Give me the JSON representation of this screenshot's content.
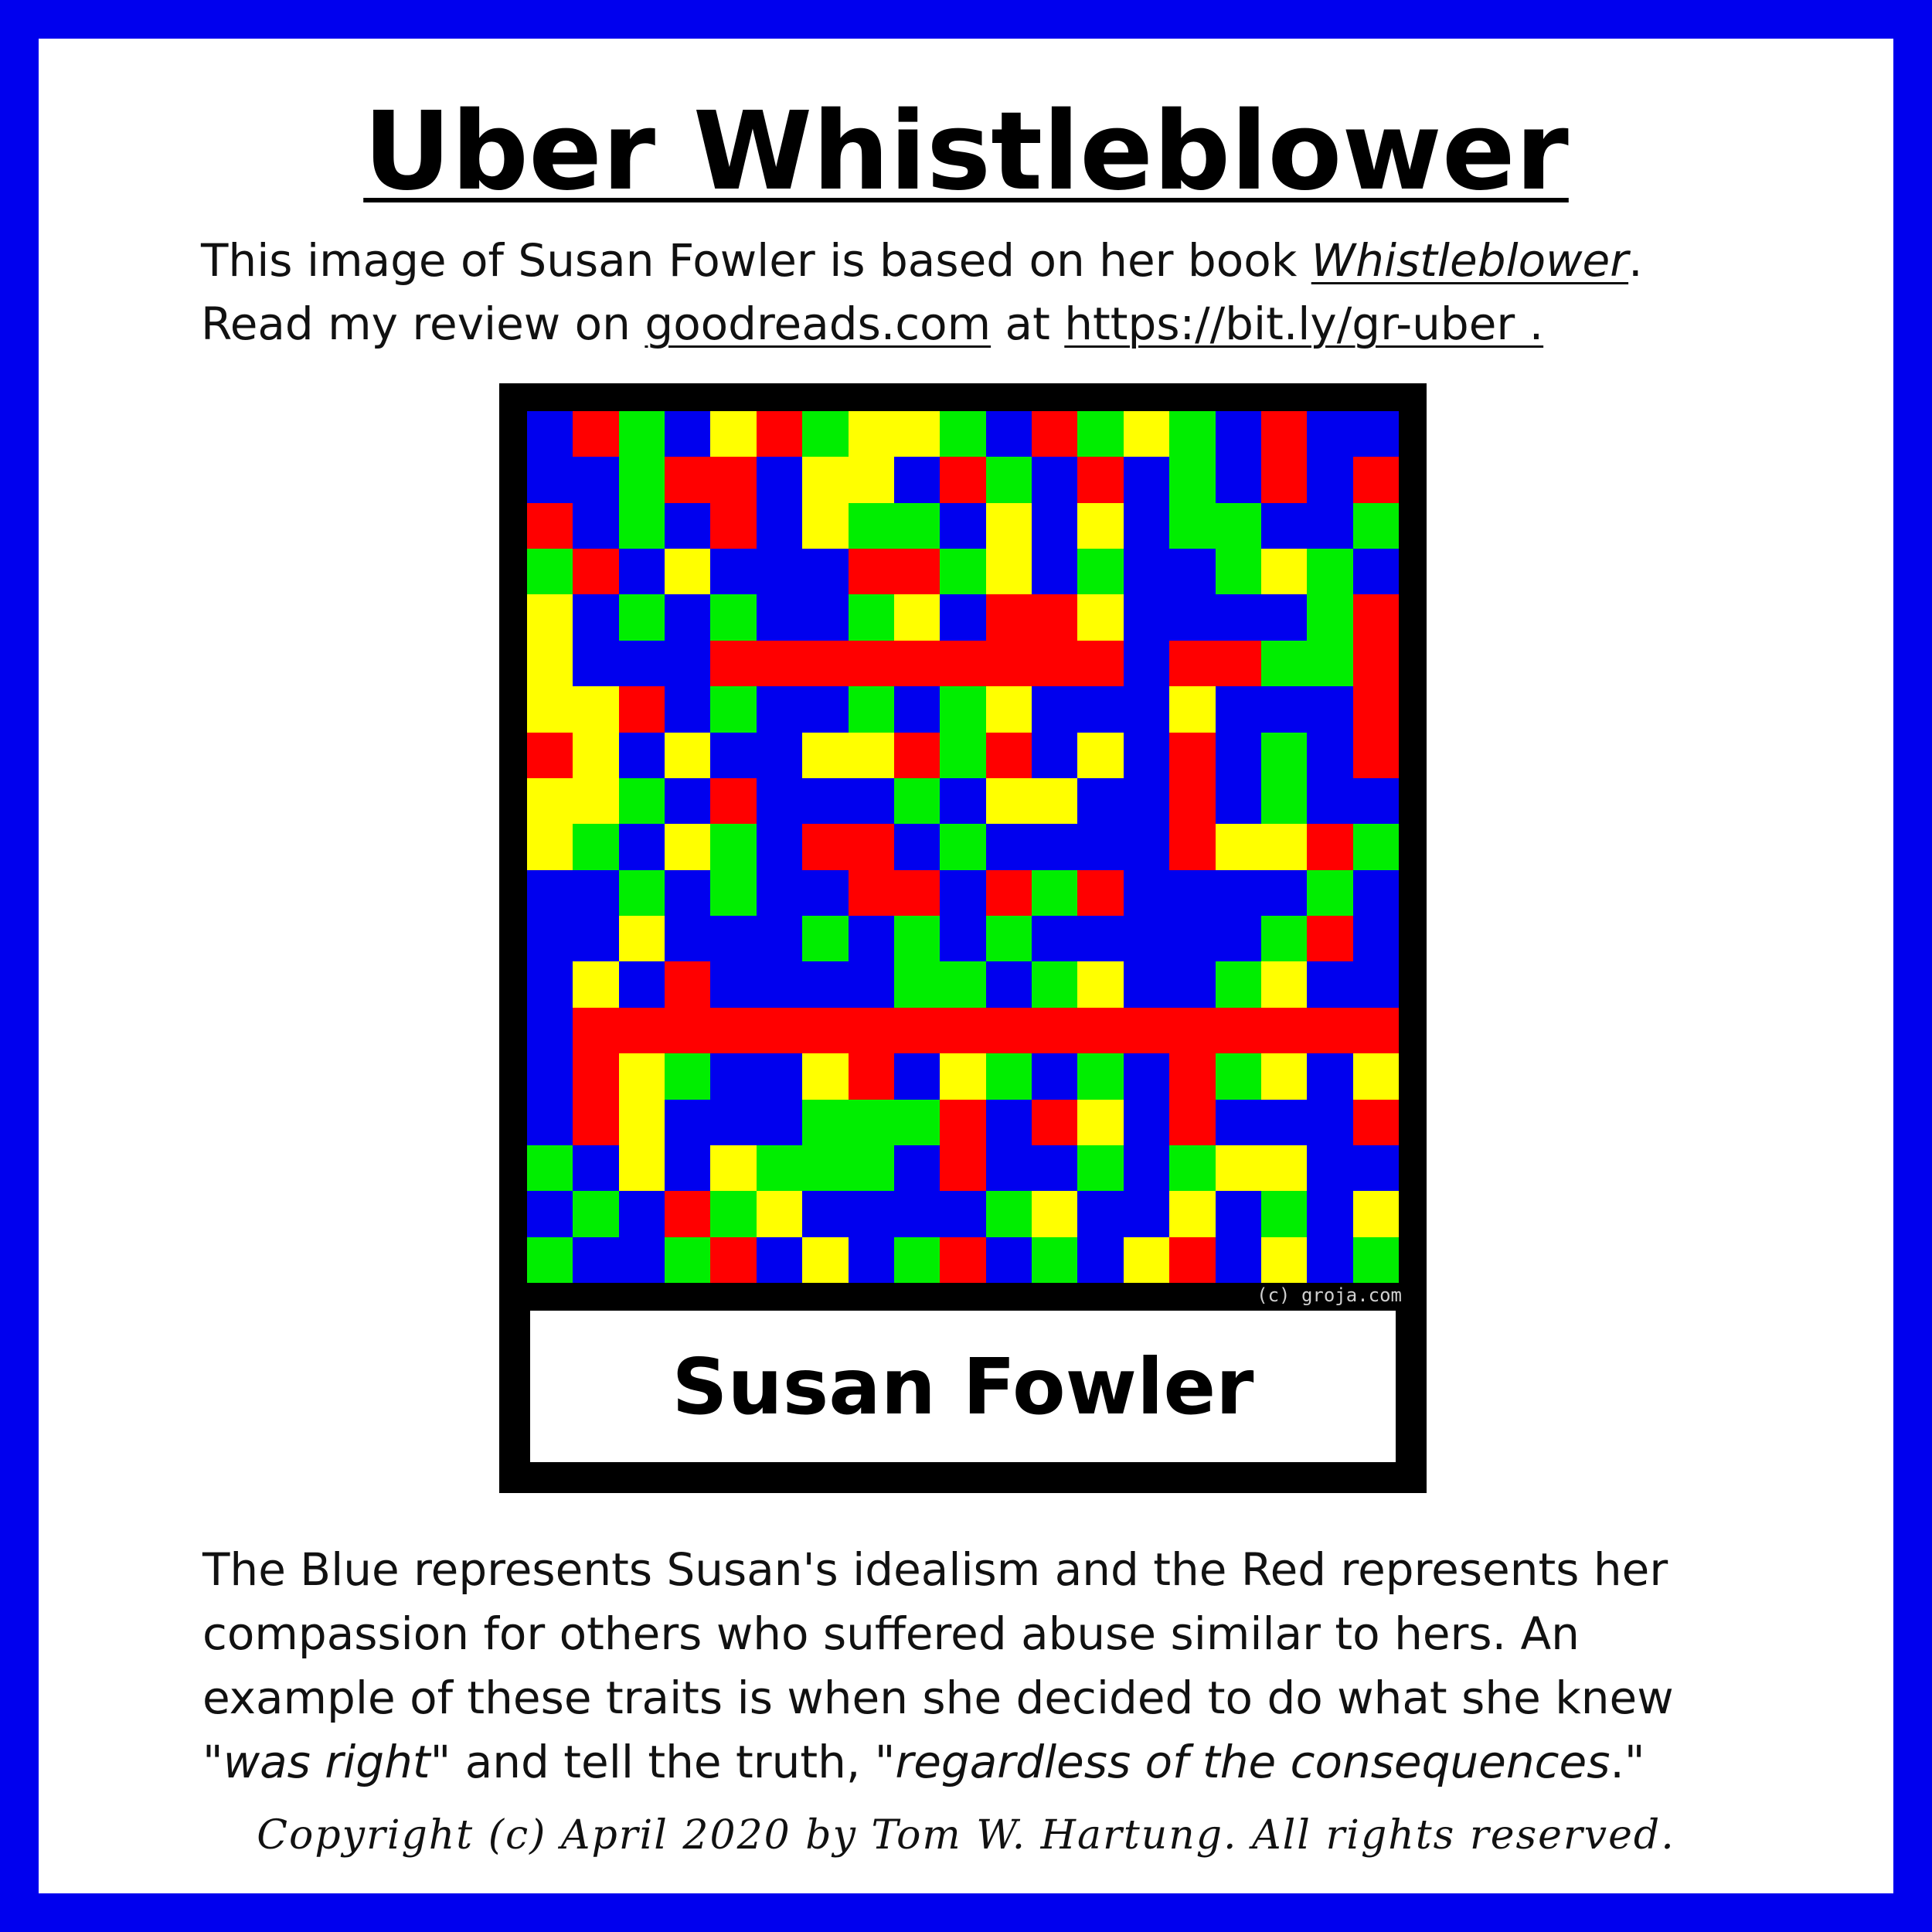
{
  "title": "Uber Whistleblower",
  "intro": {
    "line1_prefix": "This image of Susan Fowler is based on her book ",
    "book_title": "Whistleblower",
    "line1_suffix": ".",
    "line2_prefix": "Read my review on ",
    "site_link": "goodreads.com",
    "line2_middle": " at ",
    "short_link": "https://bit.ly/gr-uber .",
    "line2_suffix": ""
  },
  "card": {
    "name": "Susan Fowler",
    "credit": "(c) groja.com",
    "colors": {
      "B": "#0000ee",
      "R": "#ff0000",
      "G": "#00ee00",
      "Y": "#ffff00"
    },
    "mosaic": [
      "BRGBYRGYYGBRGYGBRBB",
      "BBGRRBYYBRGBRBGBRBR",
      "RBGBRBYGGBYBYBGGBBG",
      "GRBYBBBRRGYBGBBGYGB",
      "YBGBGBBGYBRRYBBBBGR",
      "YBBBRRRRRRRRRBRRGGR",
      "YYRBGBBGBGYBBBYBBBR",
      "RYBYBBYYRGRBYBRBGBR",
      "YYGBRBBBGBYYBBRBGBB",
      "YGBYGBRRBGBBBBRYYRG",
      "BBGBGBBRRBRGRBBBBGB",
      "BBYBBBGBGBGBBBBBGRB",
      "BYBRBBBBGGBGYBBGYBB",
      "BRRRRRRRRRRRRRRRRRR",
      "BRYGBBYRBYGBGBRGYBY",
      "BRYBBBGGGRBRYBRBBBR",
      "GBYBYGGGBRBBGBGYYBB",
      "BGBRGYBBBBGYBBYBGBY",
      "GBBGRBYBGRBGBYRBYBG"
    ]
  },
  "body_text": {
    "line1": "The Blue represents Susan's idealism and the Red represents her",
    "line2": "compassion for others who suffered abuse similar to hers.  An",
    "line3": "example of these traits is when she decided to do what she knew",
    "quote1": "was right",
    "middle": "\" and tell the truth, \"",
    "quote2": "regardless of the consequences",
    "end": ".\""
  },
  "copyright": "Copyright (c) April 2020 by Tom W. Hartung.  All rights reserved."
}
